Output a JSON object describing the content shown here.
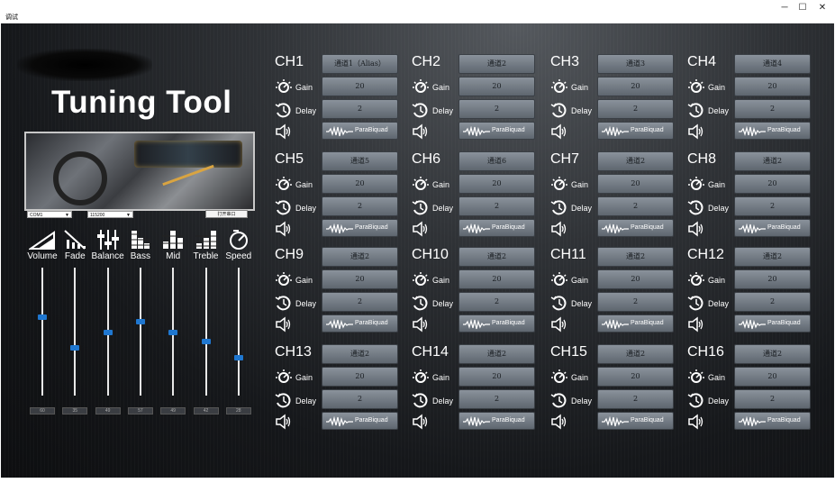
{
  "window": {
    "title": "调试"
  },
  "app": {
    "title": "Tuning Tool"
  },
  "serial": {
    "port": "COM1",
    "baud": "115200",
    "open_label": "打开串口"
  },
  "eq": [
    {
      "label": "Volume",
      "icon": "volume-ramp-icon",
      "value": "60",
      "level": 0.62
    },
    {
      "label": "Fade",
      "icon": "fade-icon",
      "value": "35",
      "level": 0.37
    },
    {
      "label": "Balance",
      "icon": "balance-sliders-icon",
      "value": "49",
      "level": 0.49
    },
    {
      "label": "Bass",
      "icon": "bass-bars-icon",
      "value": "57",
      "level": 0.58
    },
    {
      "label": "Mid",
      "icon": "mid-bars-icon",
      "value": "49",
      "level": 0.49
    },
    {
      "label": "Treble",
      "icon": "treble-bars-icon",
      "value": "42",
      "level": 0.42
    },
    {
      "label": "Speed",
      "icon": "speedometer-icon",
      "value": "28",
      "level": 0.29
    }
  ],
  "channel_labels": {
    "gain": "Gain",
    "delay": "Delay",
    "filter": "ParaBiquad"
  },
  "channels": [
    {
      "name": "CH1",
      "alias": "通道1（Alias）",
      "gain": "20",
      "delay": "2"
    },
    {
      "name": "CH2",
      "alias": "通道2",
      "gain": "20",
      "delay": "2"
    },
    {
      "name": "CH3",
      "alias": "通道3",
      "gain": "20",
      "delay": "2"
    },
    {
      "name": "CH4",
      "alias": "通道4",
      "gain": "20",
      "delay": "2"
    },
    {
      "name": "CH5",
      "alias": "通道5",
      "gain": "20",
      "delay": "2"
    },
    {
      "name": "CH6",
      "alias": "通道6",
      "gain": "20",
      "delay": "2"
    },
    {
      "name": "CH7",
      "alias": "通道2",
      "gain": "20",
      "delay": "2"
    },
    {
      "name": "CH8",
      "alias": "通道2",
      "gain": "20",
      "delay": "2"
    },
    {
      "name": "CH9",
      "alias": "通道2",
      "gain": "20",
      "delay": "2"
    },
    {
      "name": "CH10",
      "alias": "通道2",
      "gain": "20",
      "delay": "2"
    },
    {
      "name": "CH11",
      "alias": "通道2",
      "gain": "20",
      "delay": "2"
    },
    {
      "name": "CH12",
      "alias": "通道2",
      "gain": "20",
      "delay": "2"
    },
    {
      "name": "CH13",
      "alias": "通道2",
      "gain": "20",
      "delay": "2"
    },
    {
      "name": "CH14",
      "alias": "通道2",
      "gain": "20",
      "delay": "2"
    },
    {
      "name": "CH15",
      "alias": "通道2",
      "gain": "20",
      "delay": "2"
    },
    {
      "name": "CH16",
      "alias": "通道2",
      "gain": "20",
      "delay": "2"
    }
  ]
}
